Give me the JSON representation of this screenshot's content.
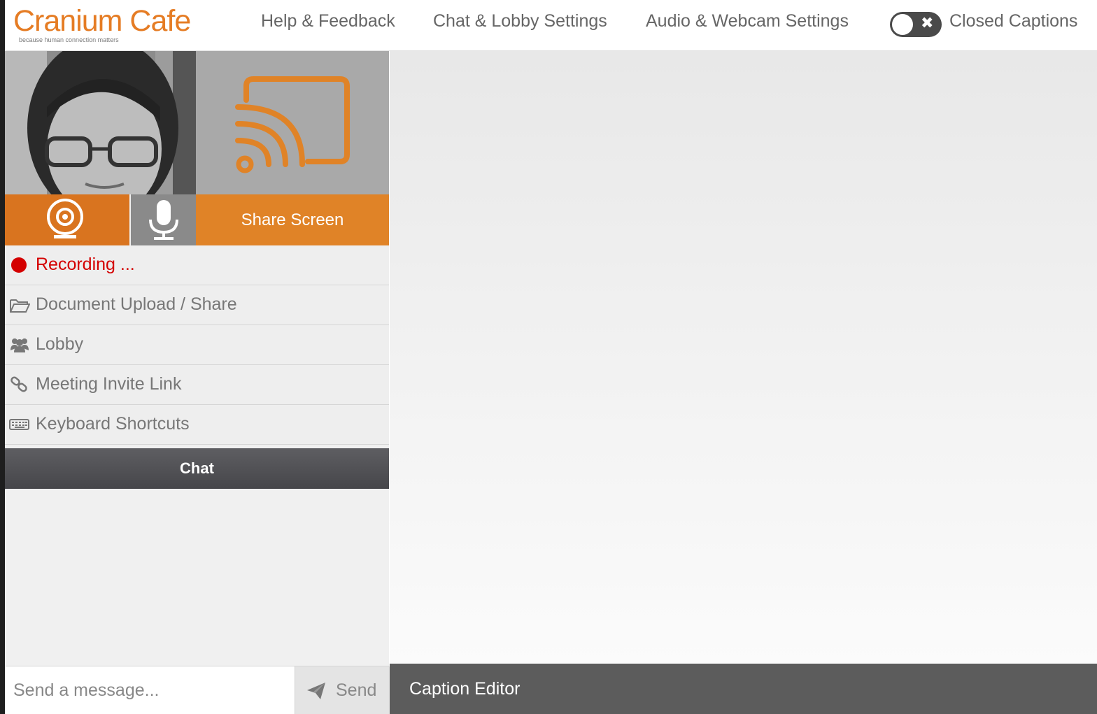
{
  "brand": {
    "logo_text": "Cranium Cafe",
    "tagline": "because human connection matters",
    "accent_color": "#e57c24"
  },
  "nav": {
    "help": "Help & Feedback",
    "chat_lobby": "Chat & Lobby Settings",
    "audio_webcam": "Audio & Webcam Settings",
    "closed_captions": {
      "label": "Closed Captions",
      "enabled": false
    }
  },
  "controls": {
    "webcam_icon": "webcam-icon",
    "mic_icon": "microphone-icon",
    "share_screen": "Share Screen",
    "cast_icon": "cast-icon"
  },
  "menu": {
    "recording": "Recording ...",
    "document": "Document Upload / Share",
    "lobby": "Lobby",
    "invite": "Meeting Invite Link",
    "shortcuts": "Keyboard Shortcuts"
  },
  "chat": {
    "title": "Chat",
    "placeholder": "Send a message...",
    "send": "Send"
  },
  "caption_editor": "Caption Editor"
}
